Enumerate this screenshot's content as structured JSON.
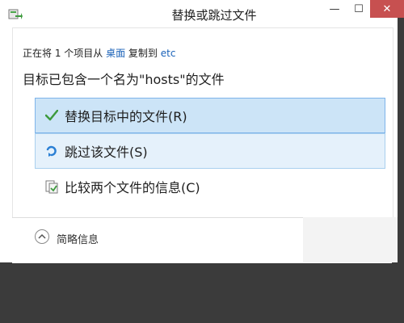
{
  "window": {
    "title": "替换或跳过文件",
    "minimize_glyph": "—",
    "maximize_glyph": "☐",
    "close_glyph": "✕"
  },
  "status": {
    "prefix": "正在将 1 个项目从 ",
    "source": "桌面",
    "middle": " 复制到 ",
    "destination": "etc"
  },
  "heading": "目标已包含一个名为\"hosts\"的文件",
  "options": [
    {
      "label": "替换目标中的文件(R)",
      "icon": "checkmark-icon"
    },
    {
      "label": "跳过该文件(S)",
      "icon": "skip-arrow-icon"
    },
    {
      "label": "比较两个文件的信息(C)",
      "icon": "compare-files-icon"
    }
  ],
  "footer": {
    "toggle_label": "简略信息",
    "toggle_icon": "chevron-up-icon"
  },
  "colors": {
    "selected_bg": "#cce4f7",
    "hover_bg": "#e5f1fb",
    "link": "#1a62b8",
    "close_button": "#c75050"
  }
}
